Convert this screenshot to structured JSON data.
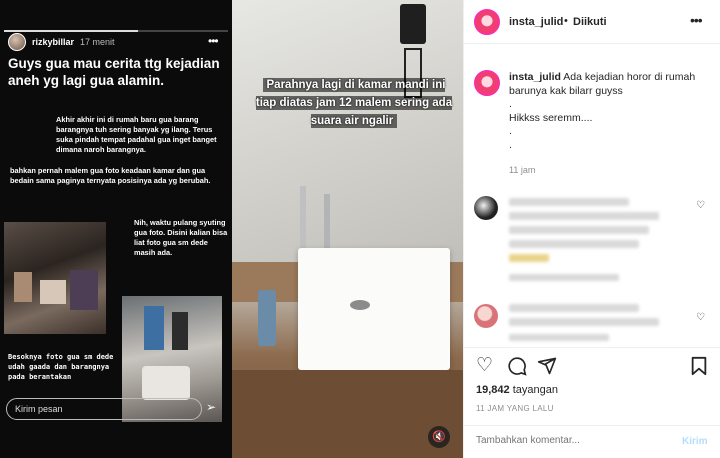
{
  "story": {
    "username": "rizkybillar",
    "time": "17 menit",
    "headline": "Guys gua mau cerita ttg kejadian aneh yg lagi gua alamin.",
    "p1": "Akhir akhir ini di rumah baru gua barang barangnya tuh sering banyak yg ilang. Terus suka pindah tempat padahal gua inget banget dimana naroh barangnya.",
    "p2": "bahkan pernah malem gua foto keadaan kamar dan gua bedain sama paginya ternyata posisinya ada yg berubah.",
    "p3": "Nih, waktu pulang syuting gua foto. Disini kalian bisa liat foto gua sm dede masih ada.",
    "p4": "Besoknya foto gua sm dede udah gaada dan barangnya pada berantakan",
    "reply_placeholder": "Kirim pesan"
  },
  "video": {
    "caption": "Parahnya lagi  di kamar mandi ini tiap diatas jam 12 malem sering ada suara air ngalir"
  },
  "post": {
    "username": "insta_julid",
    "dot": "•",
    "follow_status": "Diikuti",
    "caption_user": "insta_julid",
    "caption_lines": [
      "Ada kejadian horor di rumah barunya kak bilarr guyss",
      ".",
      "Hikkss seremm....",
      ".",
      "."
    ],
    "caption_time": "11 jam",
    "views_count": "19,842",
    "views_label": "tayangan",
    "posted_ago": "11 JAM YANG LALU",
    "comment_placeholder": "Tambahkan komentar...",
    "post_button": "Kirim"
  },
  "icons": {
    "more": "more-horizontal-icon",
    "heart": "heart-icon",
    "comment": "comment-icon",
    "share": "share-icon",
    "save": "bookmark-icon",
    "send": "send-icon",
    "mute": "speaker-muted-icon"
  }
}
